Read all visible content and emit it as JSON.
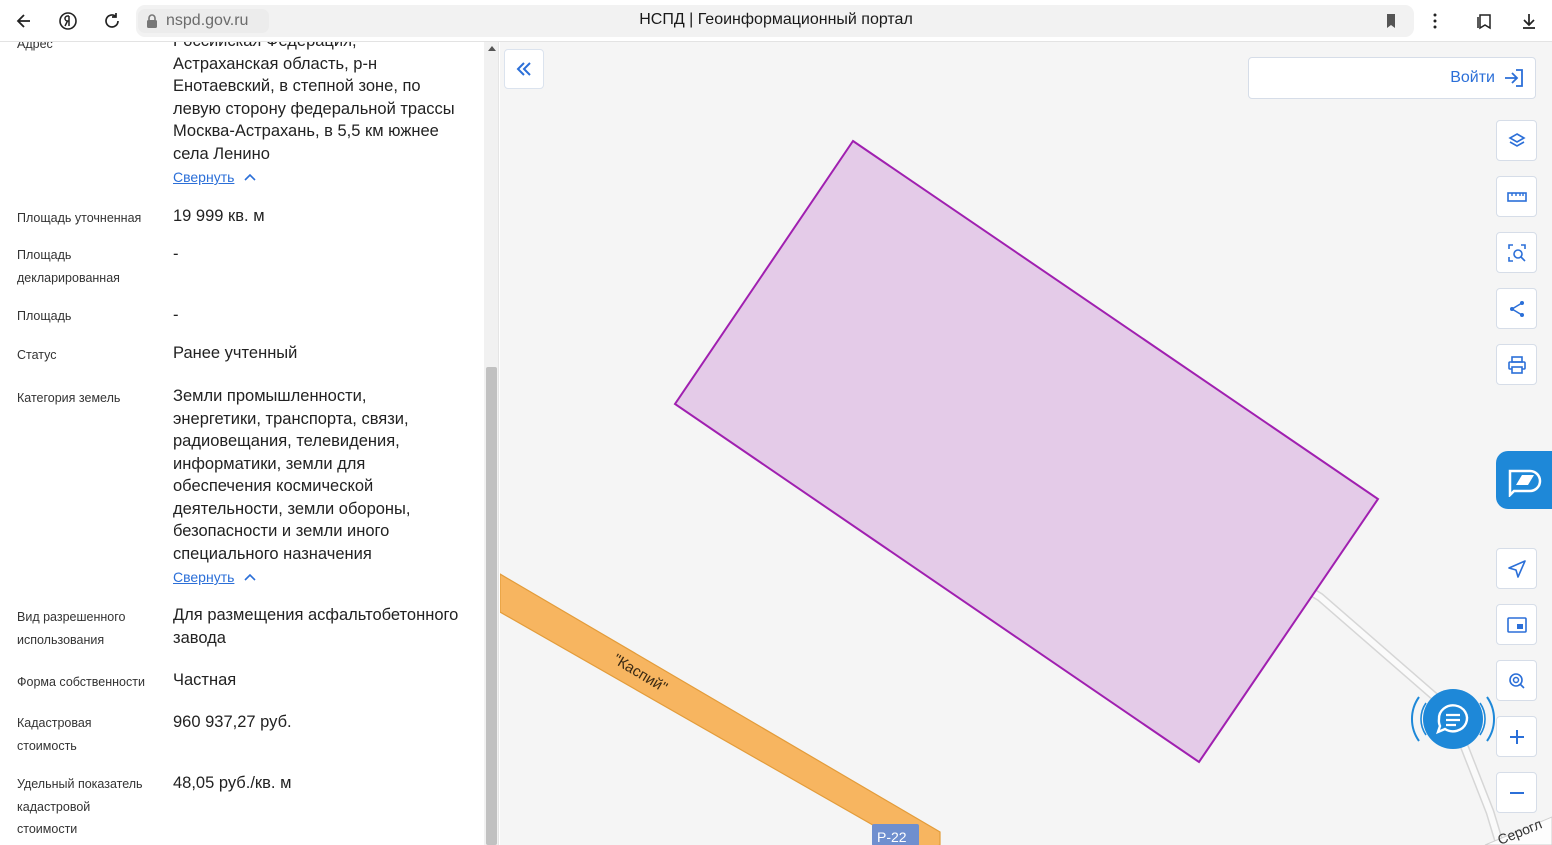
{
  "browser": {
    "url": "nspd.gov.ru",
    "title": "НСПД | Геоинформационный портал"
  },
  "panel": {
    "address": {
      "label": "Адрес",
      "lines": [
        "Российская Федерация,",
        "Астраханская область, р-н",
        "Енотаевский, в степной зоне, по",
        "левую сторону федеральной трассы",
        "Москва-Астрахань, в 5,5 км южнее",
        "села Ленино"
      ],
      "collapse": "Свернуть"
    },
    "area_refined": {
      "label": "Площадь уточненная",
      "value": "19 999 кв. м"
    },
    "area_declared": {
      "label_lines": [
        "Площадь",
        "декларированная"
      ],
      "value": "-"
    },
    "area": {
      "label": "Площадь",
      "value": "-"
    },
    "status": {
      "label": "Статус",
      "value": "Ранее учтенный"
    },
    "land_category": {
      "label": "Категория земель",
      "lines": [
        "Земли промышленности,",
        "энергетики, транспорта, связи,",
        "радиовещания, телевидения,",
        "информатики, земли для",
        "обеспечения космической",
        "деятельности, земли обороны,",
        "безопасности и земли иного",
        "специального назначения"
      ],
      "collapse": "Свернуть"
    },
    "permitted_use": {
      "label_lines": [
        "Вид разрешенного",
        "использования"
      ],
      "lines": [
        "Для размещения асфальтобетонного",
        "завода"
      ]
    },
    "ownership": {
      "label": "Форма собственности",
      "value": "Частная"
    },
    "cadastral_value": {
      "label_lines": [
        "Кадастровая",
        "стоимость"
      ],
      "value": "960 937,27 руб."
    },
    "specific_value": {
      "label_lines": [
        "Удельный показатель",
        "кадастровой",
        "стоимости"
      ],
      "value": "48,05 руб./кв. м"
    }
  },
  "map": {
    "login_label": "Войти",
    "road_label": "\"Каспий\"",
    "road_badge": "Р-22",
    "corner_label": "Серогл",
    "parcel_fill": "#e4cbe8",
    "parcel_stroke": "#a020b0",
    "road_color": "#f7b560",
    "accent": "#1e88d8",
    "tools": [
      "layers-icon",
      "ruler-icon",
      "area-select-icon",
      "share-icon",
      "print-icon",
      "geolocate-icon",
      "minimap-icon",
      "location-search-icon",
      "zoom-in-icon",
      "zoom-out-icon"
    ]
  }
}
